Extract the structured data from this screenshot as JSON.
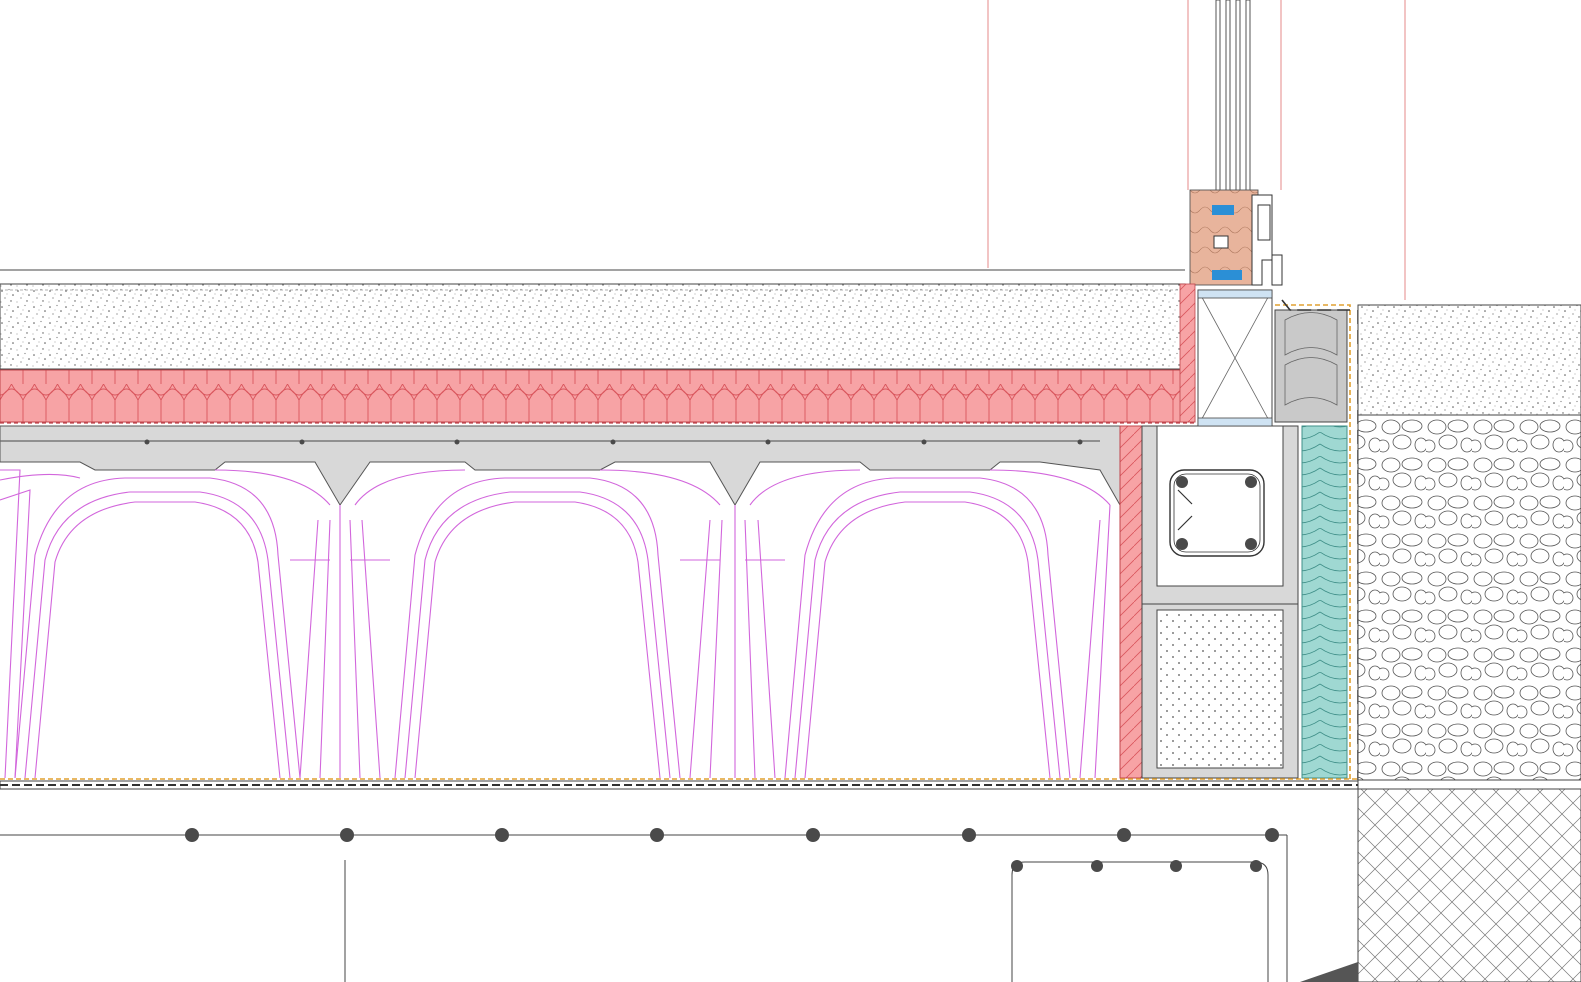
{
  "drawing": {
    "kind": "architectural construction detail section",
    "text_labels": [],
    "elements": [
      "screed-layer",
      "thermal-insulation-layer",
      "concrete-slab-topping",
      "ventilated-crawl-space-formwork",
      "perimeter-insulation-strip",
      "ring-beam",
      "reinforcement-bars",
      "foundation-block",
      "window-frame-sill",
      "external-perimeter-insulation",
      "gravel-fill",
      "ground-soil",
      "lean-concrete-base",
      "waterproofing-membrane"
    ]
  },
  "colors": {
    "insulation": "#f7a3a5",
    "insulation_line": "#d9555c",
    "formwork": "#d266dc",
    "concrete": "#d8d8d8",
    "xps_insulation": "#9fd8d2",
    "wood": "#e8b49c",
    "membrane": "#e0a030",
    "reference_line": "#e68a8a",
    "outline": "#333333",
    "rebar": "#4a4a4a",
    "blue_seal": "#2b8fd6"
  }
}
